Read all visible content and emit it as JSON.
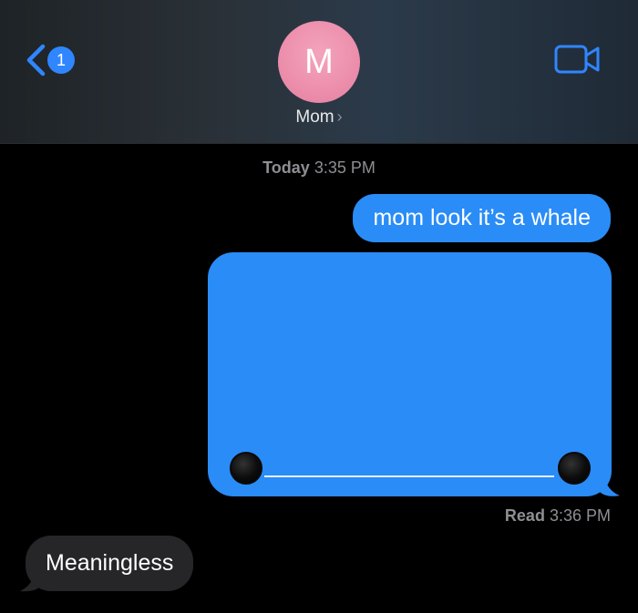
{
  "header": {
    "back_badge": "1",
    "avatar_initial": "M",
    "contact_name": "Mom",
    "contact_chevron": "›",
    "icons": [
      "chevron-left-icon",
      "video-camera-icon",
      "chevron-right-icon"
    ]
  },
  "conversation": {
    "timestamp_day": "Today",
    "timestamp_time": "3:35 PM",
    "sent_message": "mom look it’s a whale",
    "read_label": "Read",
    "read_time": "3:36 PM",
    "received_message": "Meaningless"
  },
  "colors": {
    "accent": "#2a8cf7",
    "avatar": "#ea8aa9",
    "received_bubble": "#262628",
    "secondary_text": "#8e8e93"
  }
}
